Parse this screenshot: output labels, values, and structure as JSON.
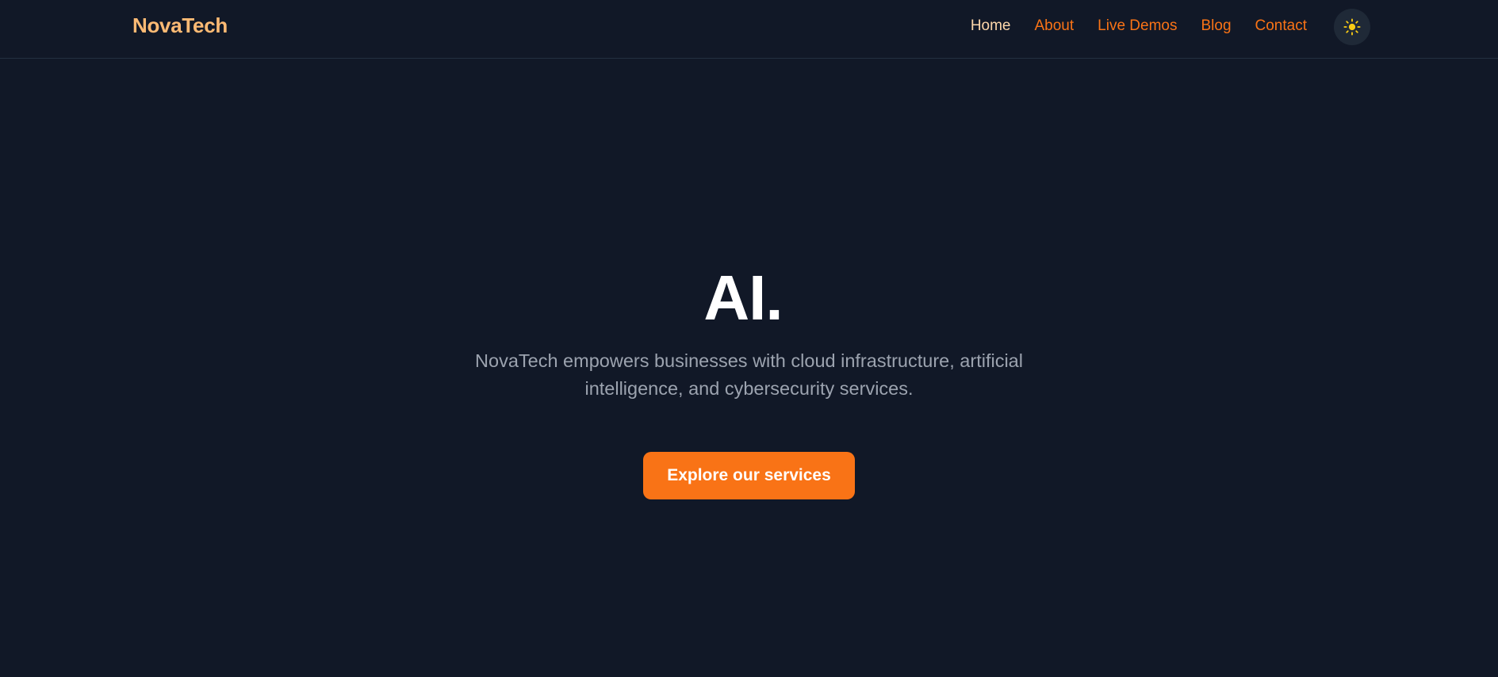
{
  "header": {
    "logo": "NovaTech",
    "nav": [
      {
        "label": "Home",
        "active": true
      },
      {
        "label": "About",
        "active": false
      },
      {
        "label": "Live Demos",
        "active": false
      },
      {
        "label": "Blog",
        "active": false
      },
      {
        "label": "Contact",
        "active": false
      }
    ],
    "theme_toggle_icon": "sun-icon"
  },
  "hero": {
    "title": "AI.",
    "subtitle": "NovaTech empowers businesses with cloud infrastructure, artificial intelligence, and cybersecurity services.",
    "cta_label": "Explore our services"
  },
  "colors": {
    "background": "#111827",
    "accent": "#f97316",
    "logo": "#fdba74",
    "nav_active": "#fed7aa",
    "sun": "#facc15"
  }
}
